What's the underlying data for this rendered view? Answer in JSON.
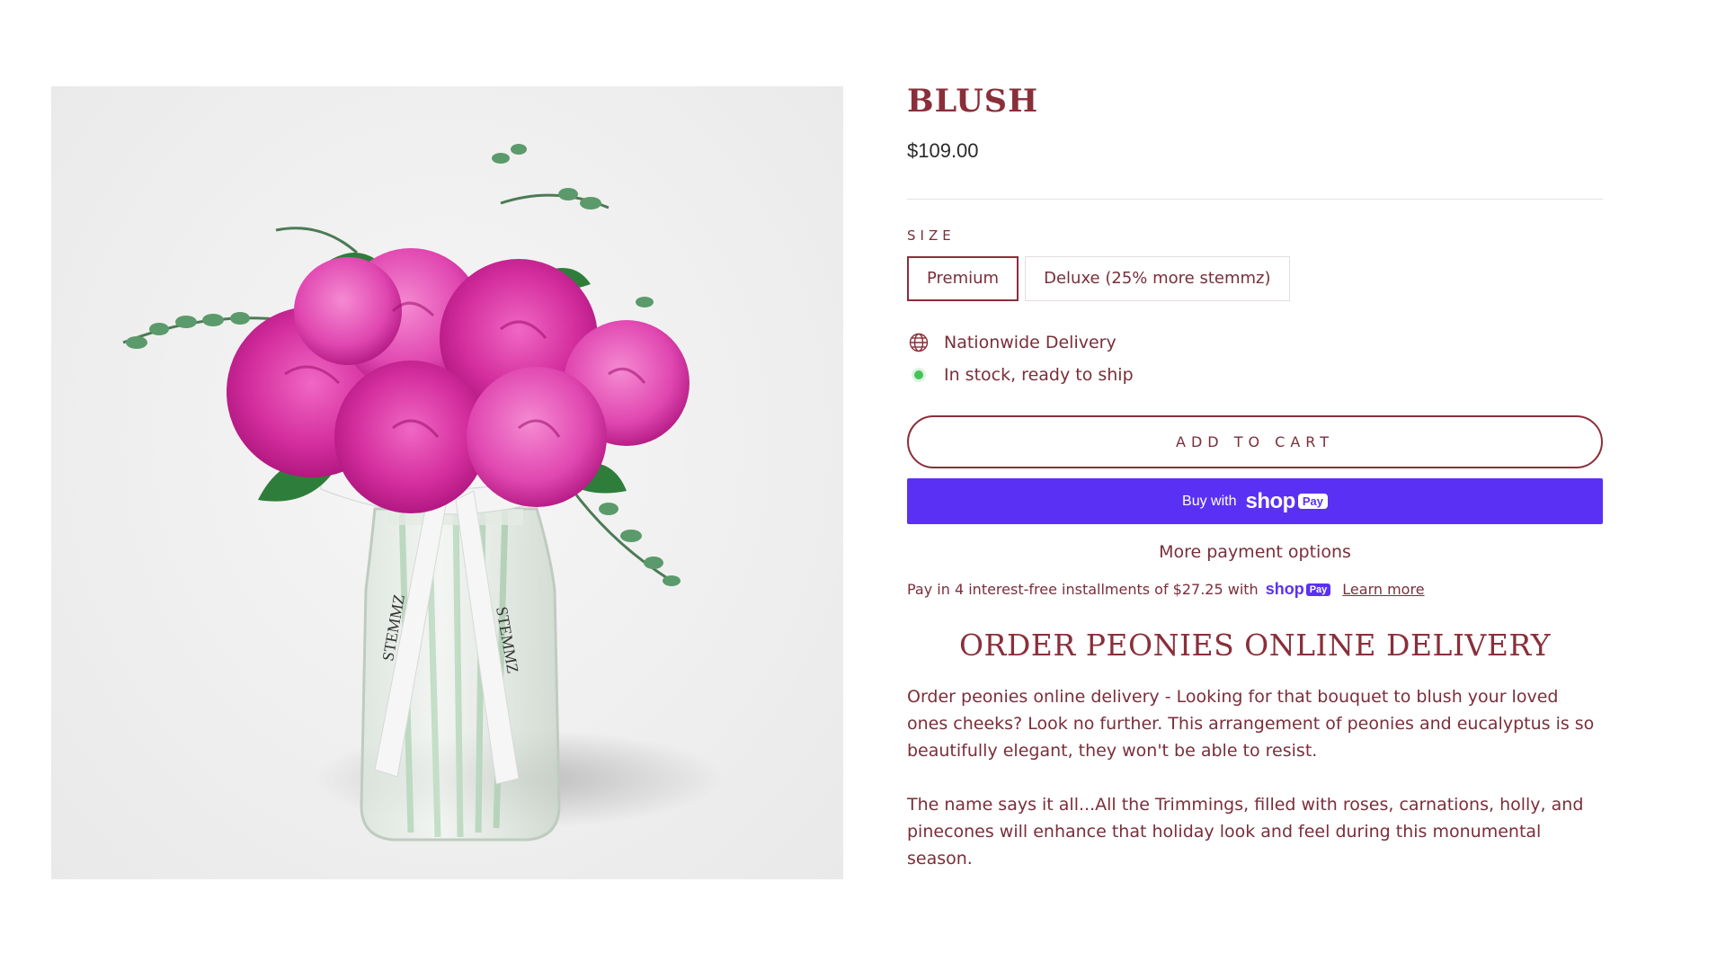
{
  "product": {
    "title": "BLUSH",
    "price": "$109.00",
    "image_alt": "peonies-bouquet-in-vase"
  },
  "size": {
    "label": "SIZE",
    "options": [
      {
        "label": "Premium",
        "selected": true
      },
      {
        "label": "Deluxe (25% more stemmz)",
        "selected": false
      }
    ]
  },
  "meta": {
    "delivery": "Nationwide Delivery",
    "stock": "In stock, ready to ship",
    "delivery_icon": "globe-icon",
    "stock_icon": "status-dot-icon",
    "stock_color": "#45c35a"
  },
  "buttons": {
    "add_to_cart": "ADD TO CART",
    "buy_with": "Buy with",
    "shop_logo": "shop",
    "pay_badge": "Pay",
    "more_payment": "More payment options"
  },
  "installments": {
    "text": "Pay in 4 interest-free installments of $27.25 with",
    "shop": "shop",
    "pay": "Pay",
    "learn_more": "Learn more"
  },
  "description": {
    "heading": "ORDER PEONIES ONLINE DELIVERY",
    "paragraphs": [
      "Order peonies online delivery - Looking for that bouquet to blush your loved ones cheeks? Look no further. This arrangement of peonies and eucalyptus is so beautifully elegant, they won't be able to resist.",
      "The name says it all...All the Trimmings, filled with roses, carnations, holly, and pinecones will enhance that holiday look and feel during this monumental season."
    ]
  },
  "colors": {
    "brand": "#8a2f3a",
    "text": "#7a2e3a",
    "shop_pay": "#5a31f4"
  }
}
